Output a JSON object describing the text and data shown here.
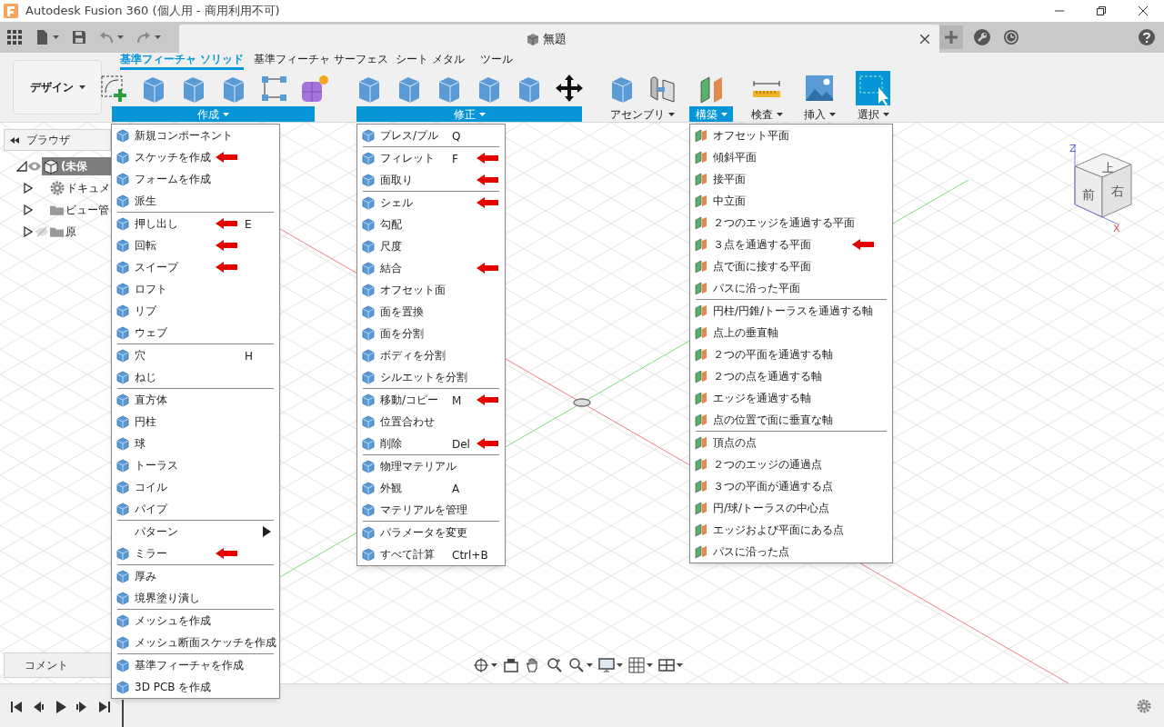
{
  "title_bar": {
    "title": "Autodesk Fusion 360 (個人用 - 商用利用不可)"
  },
  "document_tab": {
    "title": "無題"
  },
  "workspace_button": {
    "label": "デザイン"
  },
  "toolbar_tabs": [
    {
      "label": "基準フィーチャ ソリッド",
      "selected": true
    },
    {
      "label": "基準フィーチャ サーフェス",
      "selected": false
    },
    {
      "label": "シート メタル",
      "selected": false
    },
    {
      "label": "ツール",
      "selected": false
    }
  ],
  "toolbar_groups": [
    {
      "label": "作成",
      "open": true
    },
    {
      "label": "修正",
      "open": true
    },
    {
      "label": "アセンブリ",
      "open": false
    },
    {
      "label": "構築",
      "open": true
    },
    {
      "label": "検査",
      "open": false
    },
    {
      "label": "挿入",
      "open": false
    },
    {
      "label": "選択",
      "open": false
    }
  ],
  "browser": {
    "title": "ブラウザ",
    "tree": [
      {
        "label": "(未保",
        "kind": "component",
        "expanded": true,
        "visible": true,
        "selected": true,
        "children": [
          {
            "label": "ドキュメ",
            "kind": "settings",
            "expanded": false,
            "selected": false
          },
          {
            "label": "ビュー管",
            "kind": "folder",
            "expanded": false,
            "selected": false
          },
          {
            "label": "原",
            "kind": "folder",
            "expanded": false,
            "visible": false,
            "selected": false
          }
        ]
      }
    ]
  },
  "comments": {
    "title": "コメント"
  },
  "menus": [
    {
      "groups": [
        [
          {
            "label": "新規コンポーネント",
            "marked": false
          },
          {
            "label": "スケッチを作成",
            "marked": true
          },
          {
            "label": "フォームを作成",
            "marked": false
          },
          {
            "label": "派生",
            "marked": false
          }
        ],
        [
          {
            "label": "押し出し",
            "shortcut": "E",
            "marked": true
          },
          {
            "label": "回転",
            "marked": true
          },
          {
            "label": "スイープ",
            "marked": true
          },
          {
            "label": "ロフト",
            "marked": false
          },
          {
            "label": "リブ",
            "marked": false
          },
          {
            "label": "ウェブ",
            "marked": false
          }
        ],
        [
          {
            "label": "穴",
            "shortcut": "H",
            "marked": false
          },
          {
            "label": "ねじ",
            "marked": false
          }
        ],
        [
          {
            "label": "直方体",
            "marked": false
          },
          {
            "label": "円柱",
            "marked": false
          },
          {
            "label": "球",
            "marked": false
          },
          {
            "label": "トーラス",
            "marked": false
          },
          {
            "label": "コイル",
            "marked": false
          },
          {
            "label": "パイプ",
            "marked": false
          }
        ],
        [
          {
            "label": "パターン",
            "submenu": true,
            "marked": false
          },
          {
            "label": "ミラー",
            "marked": true
          }
        ],
        [
          {
            "label": "厚み",
            "marked": false
          },
          {
            "label": "境界塗り潰し",
            "marked": false
          }
        ],
        [
          {
            "label": "メッシュを作成",
            "marked": false
          },
          {
            "label": "メッシュ断面スケッチを作成",
            "marked": false
          }
        ],
        [
          {
            "label": "基準フィーチャを作成",
            "marked": false
          },
          {
            "label": "3D PCB を作成",
            "marked": false
          }
        ]
      ]
    },
    {
      "groups": [
        [
          {
            "label": "プレス/プル",
            "shortcut": "Q",
            "marked": false
          }
        ],
        [
          {
            "label": "フィレット",
            "shortcut": "F",
            "marked": true
          },
          {
            "label": "面取り",
            "marked": true
          }
        ],
        [
          {
            "label": "シェル",
            "marked": true
          },
          {
            "label": "勾配",
            "marked": false
          },
          {
            "label": "尺度",
            "marked": false
          },
          {
            "label": "結合",
            "marked": true
          },
          {
            "label": "オフセット面",
            "marked": false
          },
          {
            "label": "面を置換",
            "marked": false
          },
          {
            "label": "面を分割",
            "marked": false
          },
          {
            "label": "ボディを分割",
            "marked": false
          },
          {
            "label": "シルエットを分割",
            "marked": false
          }
        ],
        [
          {
            "label": "移動/コピー",
            "shortcut": "M",
            "marked": true
          },
          {
            "label": "位置合わせ",
            "marked": false
          },
          {
            "label": "削除",
            "shortcut": "Del",
            "marked": true
          }
        ],
        [
          {
            "label": "物理マテリアル",
            "marked": false
          },
          {
            "label": "外観",
            "shortcut": "A",
            "marked": false
          },
          {
            "label": "マテリアルを管理",
            "marked": false
          }
        ],
        [
          {
            "label": "パラメータを変更",
            "marked": false
          },
          {
            "label": "すべて計算",
            "shortcut": "Ctrl+B",
            "marked": false
          }
        ]
      ]
    },
    {
      "groups": [
        [
          {
            "label": "オフセット平面",
            "marked": false
          },
          {
            "label": "傾斜平面",
            "marked": false
          },
          {
            "label": "接平面",
            "marked": false
          },
          {
            "label": "中立面",
            "marked": false
          },
          {
            "label": "２つのエッジを通過する平面",
            "marked": false
          },
          {
            "label": "３点を通過する平面",
            "marked": true
          },
          {
            "label": "点で面に接する平面",
            "marked": false
          },
          {
            "label": "パスに沿った平面",
            "marked": false
          }
        ],
        [
          {
            "label": "円柱/円錐/トーラスを通過する軸",
            "marked": false
          },
          {
            "label": "点上の垂直軸",
            "marked": false
          },
          {
            "label": "２つの平面を通過する軸",
            "marked": false
          },
          {
            "label": "２つの点を通過する軸",
            "marked": false
          },
          {
            "label": "エッジを通過する軸",
            "marked": false
          },
          {
            "label": "点の位置で面に垂直な軸",
            "marked": false
          }
        ],
        [
          {
            "label": "頂点の点",
            "marked": false
          },
          {
            "label": "２つのエッジの通過点",
            "marked": false
          },
          {
            "label": "３つの平面が通過する点",
            "marked": false
          },
          {
            "label": "円/球/トーラスの中心点",
            "marked": false
          },
          {
            "label": "エッジおよび平面にある点",
            "marked": false
          },
          {
            "label": "パスに沿った点",
            "marked": false
          }
        ]
      ]
    }
  ],
  "viewcube": {
    "faces": [
      "上",
      "前",
      "右"
    ],
    "axes": [
      "Z",
      "X"
    ]
  }
}
